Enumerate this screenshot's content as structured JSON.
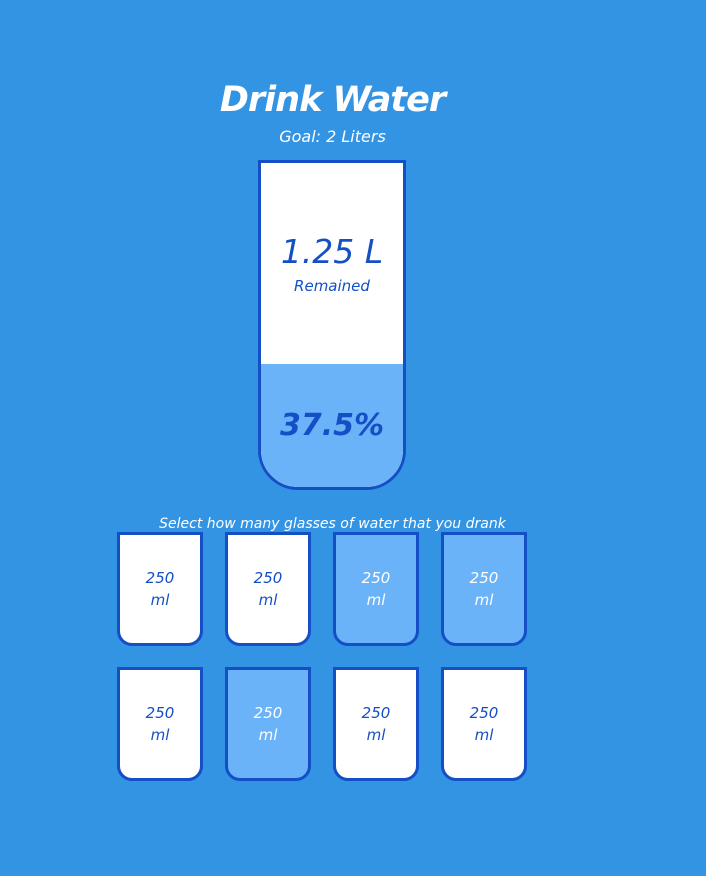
{
  "header": {
    "title": "Drink Water",
    "goal": "Goal: 2 Liters"
  },
  "big_cup": {
    "remained_value": "1.25 L",
    "remained_label": "Remained",
    "percentage": "37.5%",
    "filled_fraction": 0.375
  },
  "instruction": "Select how many glasses of water that you drank",
  "cups": [
    {
      "amount": "250",
      "unit": "ml",
      "full": false
    },
    {
      "amount": "250",
      "unit": "ml",
      "full": false
    },
    {
      "amount": "250",
      "unit": "ml",
      "full": true
    },
    {
      "amount": "250",
      "unit": "ml",
      "full": true
    },
    {
      "amount": "250",
      "unit": "ml",
      "full": false
    },
    {
      "amount": "250",
      "unit": "ml",
      "full": true
    },
    {
      "amount": "250",
      "unit": "ml",
      "full": false
    },
    {
      "amount": "250",
      "unit": "ml",
      "full": false
    }
  ],
  "colors": {
    "background": "#3494e4",
    "water": "#6ab3f8",
    "border": "#144fc6"
  }
}
